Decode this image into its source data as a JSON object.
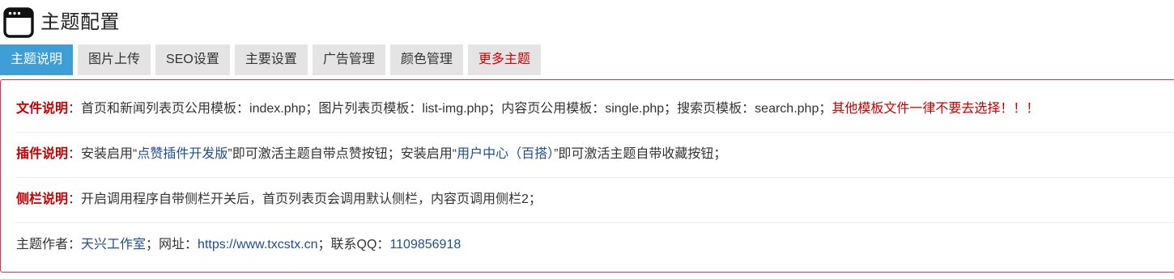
{
  "header": {
    "title": "主题配置",
    "icon": "window-icon"
  },
  "tabs": [
    {
      "label": "主题说明",
      "active": true
    },
    {
      "label": "图片上传"
    },
    {
      "label": "SEO设置"
    },
    {
      "label": "主要设置"
    },
    {
      "label": "广告管理"
    },
    {
      "label": "颜色管理"
    },
    {
      "label": "更多主题",
      "color": "#d40000"
    }
  ],
  "panel": {
    "file": {
      "label": "文件说明",
      "sep": "：",
      "text": "首页和新闻列表页公用模板：index.php；图片列表页模板：list-img.php；内容页公用模板：single.php；搜索页模板：search.php；",
      "warning": "其他模板文件一律不要去选择！！！"
    },
    "plugin": {
      "label": "插件说明",
      "sep": "：",
      "text1": "安装启用“",
      "link1": "点赞插件开发版",
      "text2": "”即可激活主题自带点赞按钮；安装启用“",
      "link2": "用户中心（百搭）",
      "text3": "”即可激活主题自带收藏按钮；"
    },
    "sidebar": {
      "label": "侧栏说明",
      "sep": "：",
      "text": "开启调用程序自带侧栏开关后，首页列表页会调用默认侧栏，内容页调用侧栏2；"
    },
    "author": {
      "prefix": "主题作者：",
      "name": "天兴工作室",
      "url_prefix": "；网址：",
      "url": "https://www.txcstx.cn",
      "qq_prefix": "；联系QQ：",
      "qq": "1109856918"
    }
  },
  "colors": {
    "accent": "#3d9fd6",
    "warning": "#c00000",
    "link": "#1f4e8c",
    "panel_border": "#d9304b"
  }
}
